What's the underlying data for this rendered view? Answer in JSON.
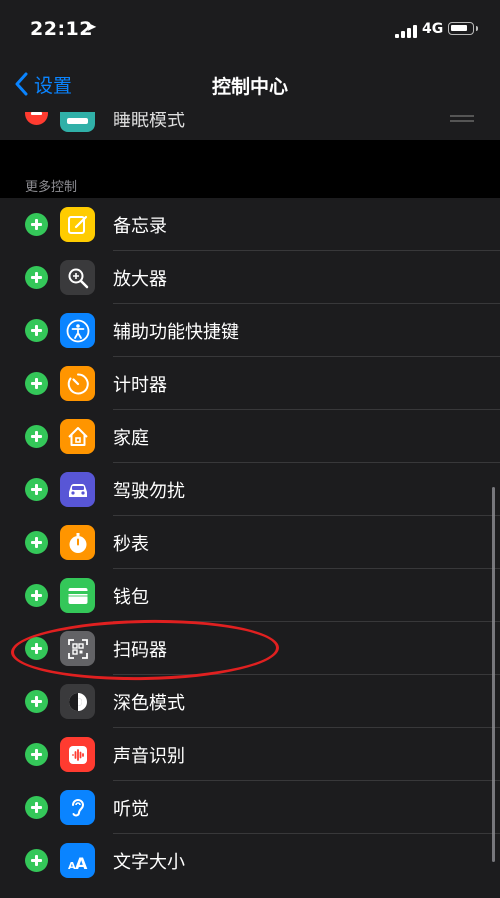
{
  "status_bar": {
    "time": "22:12",
    "network": "4G"
  },
  "nav": {
    "back_label": "设置",
    "title": "控制中心"
  },
  "included_partial": {
    "label": "睡眠模式"
  },
  "section": {
    "header": "更多控制"
  },
  "items": [
    {
      "label": "备忘录",
      "icon": "notes-icon",
      "color": "#ffcc00"
    },
    {
      "label": "放大器",
      "icon": "magnifier-icon",
      "color": "#3a3a3c"
    },
    {
      "label": "辅助功能快捷键",
      "icon": "accessibility-icon",
      "color": "#0a84ff"
    },
    {
      "label": "计时器",
      "icon": "timer-icon",
      "color": "#ff9500"
    },
    {
      "label": "家庭",
      "icon": "home-icon",
      "color": "#ff9500"
    },
    {
      "label": "驾驶勿扰",
      "icon": "car-icon",
      "color": "#5856d6"
    },
    {
      "label": "秒表",
      "icon": "stopwatch-icon",
      "color": "#ff9500"
    },
    {
      "label": "钱包",
      "icon": "wallet-icon",
      "color": "#34c759"
    },
    {
      "label": "扫码器",
      "icon": "qr-scanner-icon",
      "color": "#636366"
    },
    {
      "label": "深色模式",
      "icon": "dark-mode-icon",
      "color": "#3a3a3c"
    },
    {
      "label": "声音识别",
      "icon": "sound-recognition-icon",
      "color": "#ff3b30"
    },
    {
      "label": "听觉",
      "icon": "hearing-icon",
      "color": "#0a84ff"
    },
    {
      "label": "文字大小",
      "icon": "text-size-icon",
      "color": "#0a84ff"
    }
  ]
}
